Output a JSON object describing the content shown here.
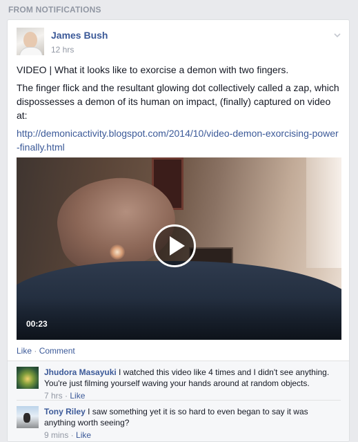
{
  "section": {
    "label": "FROM NOTIFICATIONS"
  },
  "post": {
    "author": "James Bush",
    "timestamp": "12 hrs",
    "text_line1": "VIDEO | What it looks like to exorcise a demon with two fingers.",
    "text_line2": "The finger flick and the resultant glowing dot collectively called a zap, which dispossesses a demon of its human on impact, (finally) captured on video at:",
    "link": "http://demonicactivity.blogspot.com/2014/10/video-demon-exorcising-power-finally.html",
    "video": {
      "duration": "00:23"
    },
    "actions": {
      "like": "Like",
      "separator": " · ",
      "comment": "Comment"
    }
  },
  "comments": [
    {
      "author": "Jhudora Masayuki",
      "text": "I watched this video like 4 times and I didn't see anything. You're just filming yourself waving your hands around at random objects.",
      "time": "7 hrs",
      "separator": " · ",
      "like": "Like"
    },
    {
      "author": "Tony Riley",
      "text": "I saw something yet it is so hard to even began to say it was anything worth seeing?",
      "time": "9 mins",
      "separator": " · ",
      "like": "Like"
    }
  ],
  "icons": {
    "chevron": "chevron-down-icon",
    "play": "play-icon"
  },
  "colors": {
    "link": "#3b5998",
    "meta": "#9197a3",
    "background": "#e9eaed"
  }
}
